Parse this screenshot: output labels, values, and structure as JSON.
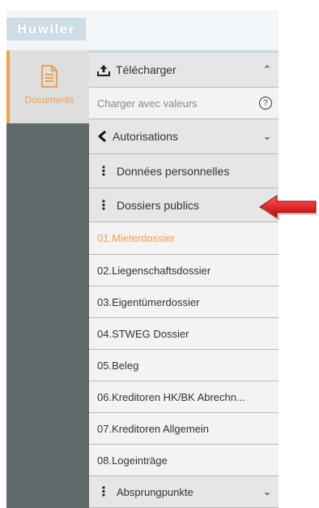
{
  "brand": {
    "logo_text": "Huwiler"
  },
  "sidebar": {
    "documents_label": "Documents"
  },
  "panel": {
    "upload_label": "Télécharger",
    "load_with_values_label": "Charger avec valeurs",
    "help_symbol": "?",
    "permissions_label": "Autorisations",
    "personal_data_label": "Données personnelles",
    "public_files_label": "Dossiers publics",
    "items": [
      "01.Mieterdossier",
      "02.Liegenschaftsdossier",
      "03.Eigentümerdossier",
      "04.STWEG Dossier",
      "05.Beleg",
      "06.Kreditoren HK/BK Abrechn...",
      "07.Kreditoren Allgemein",
      "08.Logeinträge"
    ],
    "entry_points_label": "Absprungpunkte"
  },
  "colors": {
    "accent": "#f0a04a",
    "rail": "#5e6a6c",
    "arrow": "#e02020"
  }
}
